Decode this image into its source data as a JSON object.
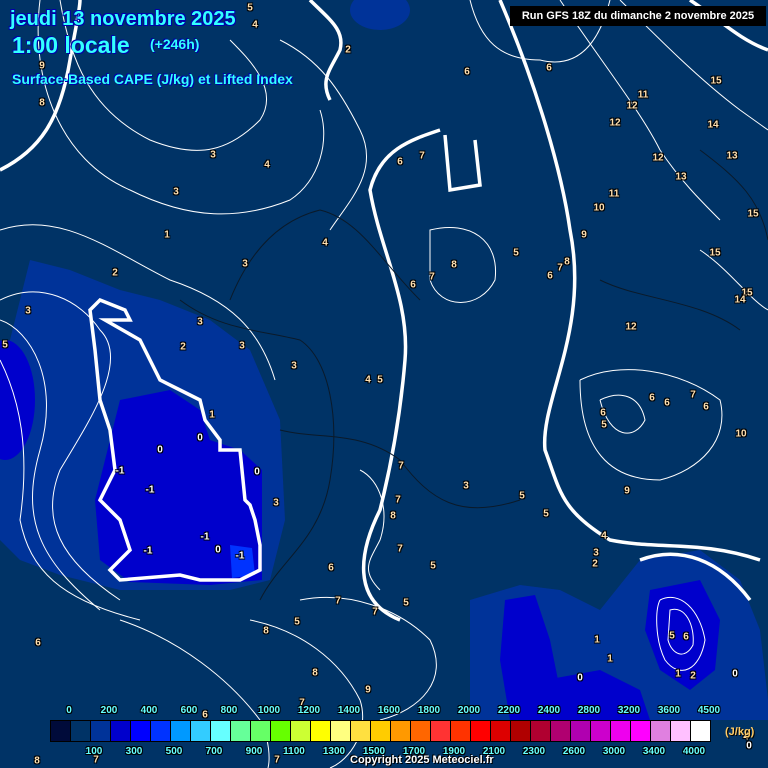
{
  "header": {
    "date": "jeudi 13 novembre 2025",
    "time": "1:00 locale",
    "lead": "(+246h)",
    "title": "Surface-Based CAPE (J/kg) et Lifted Index",
    "run": "Run GFS 18Z du dimanche 2 novembre 2025"
  },
  "legend": {
    "unit": "(J/kg)",
    "top_labels": [
      "0",
      "200",
      "400",
      "600",
      "800",
      "1000",
      "1200",
      "1400",
      "1600",
      "1800",
      "2000",
      "2200",
      "2400",
      "2800",
      "3200",
      "3600",
      "4500"
    ],
    "bottom_labels": [
      "100",
      "300",
      "500",
      "700",
      "900",
      "1100",
      "1300",
      "1500",
      "1700",
      "1900",
      "2100",
      "2300",
      "2600",
      "3000",
      "3400",
      "4000"
    ],
    "colors": [
      "#000b3a",
      "#003366",
      "#003399",
      "#0000cc",
      "#0000ff",
      "#0033ff",
      "#0099ff",
      "#33ccff",
      "#66ffff",
      "#66ff99",
      "#66ff66",
      "#66ff00",
      "#ccff33",
      "#ffff00",
      "#ffff80",
      "#ffe040",
      "#ffcc00",
      "#ff9900",
      "#ff6600",
      "#ff3333",
      "#ff3300",
      "#ff0000",
      "#dd0000",
      "#b00000",
      "#b00030",
      "#b00070",
      "#b000b0",
      "#cc00cc",
      "#ee00ee",
      "#ff00ff",
      "#e080e0",
      "#ffc0ff",
      "#ffffff"
    ]
  },
  "lifted_index_labels": [
    "5",
    "4",
    "2",
    "9",
    "8",
    "3",
    "4",
    "3",
    "1",
    "2",
    "3",
    "4",
    "3",
    "3",
    "2",
    "3",
    "3",
    "5",
    "1",
    "0",
    "0",
    "-1",
    "-1",
    "0",
    "3",
    "-1",
    "0",
    "-1",
    "-1",
    "6",
    "7",
    "6",
    "6",
    "11",
    "12",
    "12",
    "14",
    "12",
    "13",
    "13",
    "11",
    "10",
    "9",
    "15",
    "15",
    "15",
    "15",
    "14",
    "8",
    "5",
    "6",
    "7",
    "8",
    "7",
    "6",
    "4",
    "5",
    "12",
    "7",
    "6",
    "6",
    "6",
    "6",
    "5",
    "10",
    "7",
    "3",
    "5",
    "9",
    "7",
    "8",
    "5",
    "4",
    "3",
    "2",
    "7",
    "5",
    "6",
    "7",
    "7",
    "5",
    "5",
    "8",
    "6",
    "1",
    "1",
    "5",
    "6",
    "1",
    "2",
    "0",
    "0",
    "8",
    "9",
    "7",
    "4",
    "0",
    "8",
    "7",
    "7",
    "6"
  ],
  "footer": {
    "copyright": "Copyright 2025 Meteociel.fr"
  }
}
